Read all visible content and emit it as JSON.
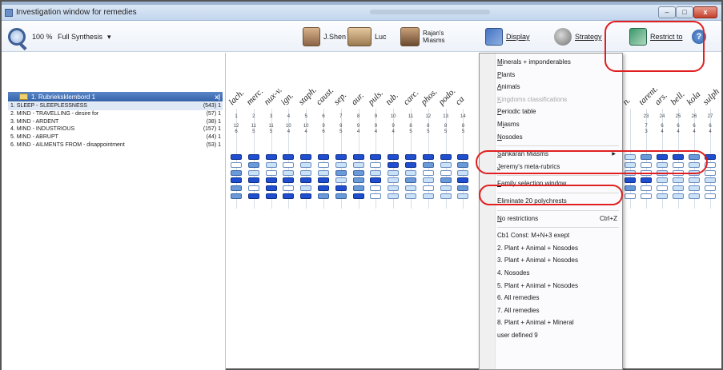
{
  "window": {
    "title": "Investigation window for remedies",
    "controls": {
      "minimize": "–",
      "maximize": "□",
      "close": "x"
    }
  },
  "toolbar": {
    "zoom": "100 %",
    "mode": "Full Synthesis",
    "mode_arrow": "▾",
    "users": [
      "J.Shen",
      "Luc",
      "Rajan's Miasms"
    ],
    "display": "Display",
    "strategy": "Strategy",
    "restrict": "Restrict to",
    "help": "?"
  },
  "rubric_panel": {
    "header": "1. Rubrieksklembord 1",
    "close": "x|",
    "rows": [
      {
        "name": "1. SLEEP - SLEEPLESSNESS",
        "count": "(543) 1"
      },
      {
        "name": "2. MIND - TRAVELLING - desire for",
        "count": "(57) 1"
      },
      {
        "name": "3. MIND - ARDENT",
        "count": "(38) 1"
      },
      {
        "name": "4. MIND - INDUSTRIOUS",
        "count": "(157) 1"
      },
      {
        "name": "5. MIND - ABRUPT",
        "count": "(44) 1"
      },
      {
        "name": "6. MIND - AILMENTS FROM - disappointment",
        "count": "(53) 1"
      }
    ]
  },
  "remedies": [
    {
      "name": "lach.",
      "num": "1",
      "s1": "12",
      "s2": "6"
    },
    {
      "name": "merc.",
      "num": "2",
      "s1": "11",
      "s2": "5"
    },
    {
      "name": "nux-v.",
      "num": "3",
      "s1": "11",
      "s2": "5"
    },
    {
      "name": "ign.",
      "num": "4",
      "s1": "10",
      "s2": "4"
    },
    {
      "name": "staph.",
      "num": "5",
      "s1": "10",
      "s2": "4"
    },
    {
      "name": "caust.",
      "num": "6",
      "s1": "9",
      "s2": "6"
    },
    {
      "name": "sep.",
      "num": "7",
      "s1": "9",
      "s2": "5"
    },
    {
      "name": "aur.",
      "num": "8",
      "s1": "9",
      "s2": "4"
    },
    {
      "name": "puls.",
      "num": "9",
      "s1": "9",
      "s2": "4"
    },
    {
      "name": "tub.",
      "num": "10",
      "s1": "9",
      "s2": "4"
    },
    {
      "name": "carc.",
      "num": "11",
      "s1": "8",
      "s2": "5"
    },
    {
      "name": "phos.",
      "num": "12",
      "s1": "8",
      "s2": "5"
    },
    {
      "name": "podo.",
      "num": "13",
      "s1": "8",
      "s2": "5"
    },
    {
      "name": "ca",
      "num": "14",
      "s1": "8",
      "s2": "5"
    }
  ],
  "remedies_right": [
    {
      "name": "n.",
      "num": "",
      "s1": "",
      "s2": ""
    },
    {
      "name": "tarent.",
      "num": "23",
      "s1": "7",
      "s2": "3"
    },
    {
      "name": "ars.",
      "num": "24",
      "s1": "6",
      "s2": "4"
    },
    {
      "name": "bell.",
      "num": "25",
      "s1": "6",
      "s2": "4"
    },
    {
      "name": "kola",
      "num": "26",
      "s1": "6",
      "s2": "4"
    },
    {
      "name": "sulph",
      "num": "27",
      "s1": "6",
      "s2": "4"
    }
  ],
  "grid_levels": [
    [
      3,
      3,
      3,
      3,
      3,
      3,
      3,
      3,
      3,
      3,
      3,
      3,
      3,
      3
    ],
    [
      0,
      2,
      1,
      0,
      1,
      0,
      1,
      1,
      0,
      3,
      3,
      2,
      1,
      2
    ],
    [
      2,
      1,
      0,
      1,
      1,
      1,
      2,
      2,
      1,
      1,
      1,
      0,
      0,
      1
    ],
    [
      3,
      3,
      3,
      3,
      3,
      3,
      1,
      2,
      3,
      1,
      2,
      1,
      2,
      3
    ],
    [
      2,
      0,
      3,
      0,
      1,
      3,
      3,
      2,
      0,
      1,
      1,
      0,
      1,
      2
    ],
    [
      2,
      3,
      3,
      3,
      3,
      2,
      2,
      3,
      0,
      1,
      1,
      1,
      1,
      1
    ]
  ],
  "grid_levels_right": [
    [
      1,
      2,
      3,
      3,
      2,
      3
    ],
    [
      1,
      0,
      1,
      0,
      1,
      0
    ],
    [
      1,
      0,
      1,
      0,
      1,
      0
    ],
    [
      3,
      3,
      1,
      1,
      1,
      1
    ],
    [
      2,
      0,
      0,
      1,
      1,
      0
    ],
    [
      0,
      0,
      1,
      1,
      1,
      0
    ]
  ],
  "menu": {
    "items": [
      {
        "label": "Minerals + imponderables",
        "accel": "M"
      },
      {
        "label": "Plants",
        "accel": "P"
      },
      {
        "label": "Animals",
        "accel": "A"
      },
      {
        "label": "Kingdoms classifications",
        "accel": "K",
        "disabled": true
      },
      {
        "label": "Periodic table",
        "accel": "P"
      },
      {
        "label": "Miasms",
        "accel": "i"
      },
      {
        "label": "Nosodes",
        "accel": "N"
      },
      {
        "label": "Sankaran Miasms",
        "accel": "S",
        "submenu": true,
        "submenu_arrow": "▶"
      },
      {
        "label": "Jeremy's meta-rubrics",
        "accel": "J"
      },
      {
        "label": "Family selection window",
        "accel": "F"
      },
      {
        "label": "Eliminate 20 polychrests",
        "accel": "E"
      },
      {
        "label": "No restrictions",
        "accel": "N",
        "shortcut": "Ctrl+Z"
      },
      {
        "label": "Cb1 Const: M+N+3 exept"
      },
      {
        "label": "2. Plant + Animal + Nosodes"
      },
      {
        "label": "3. Plant + Animal + Nosodes"
      },
      {
        "label": "4. Nosodes"
      },
      {
        "label": "5. Plant + Animal + Nosodes"
      },
      {
        "label": "6. All remedies"
      },
      {
        "label": "7. All remedies"
      },
      {
        "label": "8. Plant + Animal + Mineral"
      },
      {
        "label": "user defined 9"
      }
    ]
  },
  "colors": {
    "highlight_circle": "#e02020",
    "grade3": "#1f4fd0",
    "grade2": "#6a9ad8",
    "grade1": "#c9e2f8"
  }
}
